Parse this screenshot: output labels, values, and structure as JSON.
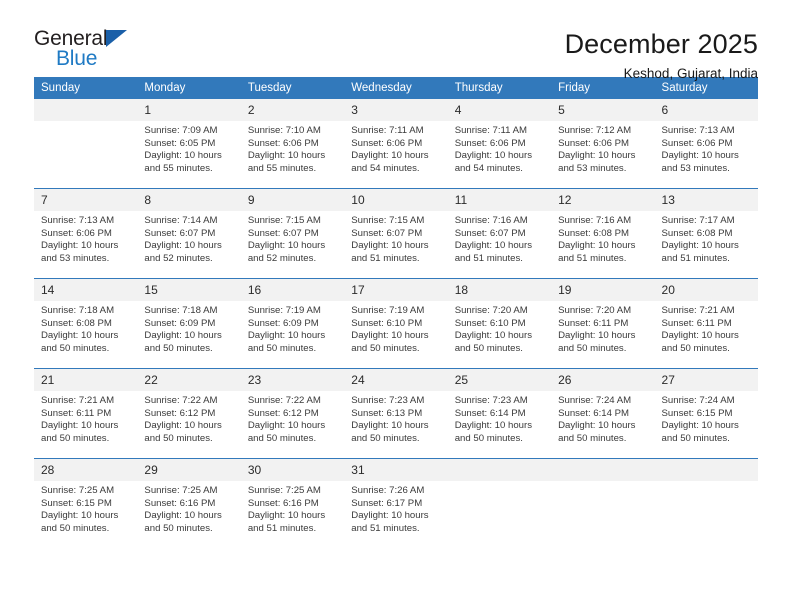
{
  "brand": {
    "name_part1": "General",
    "name_part2": "Blue",
    "accent_color": "#1f7ac4",
    "triangle_color": "#1a5fa8"
  },
  "header": {
    "title": "December 2025",
    "subtitle": "Keshod, Gujarat, India"
  },
  "calendar": {
    "header_bg": "#3279bb",
    "daynum_bg": "#f2f2f2",
    "weekday_headers": [
      "Sunday",
      "Monday",
      "Tuesday",
      "Wednesday",
      "Thursday",
      "Friday",
      "Saturday"
    ],
    "weeks": [
      [
        {
          "day": "",
          "sunrise": "",
          "sunset": "",
          "daylight_line1": "",
          "daylight_line2": "",
          "blank": true
        },
        {
          "day": "1",
          "sunrise": "Sunrise: 7:09 AM",
          "sunset": "Sunset: 6:05 PM",
          "daylight_line1": "Daylight: 10 hours",
          "daylight_line2": "and 55 minutes."
        },
        {
          "day": "2",
          "sunrise": "Sunrise: 7:10 AM",
          "sunset": "Sunset: 6:06 PM",
          "daylight_line1": "Daylight: 10 hours",
          "daylight_line2": "and 55 minutes."
        },
        {
          "day": "3",
          "sunrise": "Sunrise: 7:11 AM",
          "sunset": "Sunset: 6:06 PM",
          "daylight_line1": "Daylight: 10 hours",
          "daylight_line2": "and 54 minutes."
        },
        {
          "day": "4",
          "sunrise": "Sunrise: 7:11 AM",
          "sunset": "Sunset: 6:06 PM",
          "daylight_line1": "Daylight: 10 hours",
          "daylight_line2": "and 54 minutes."
        },
        {
          "day": "5",
          "sunrise": "Sunrise: 7:12 AM",
          "sunset": "Sunset: 6:06 PM",
          "daylight_line1": "Daylight: 10 hours",
          "daylight_line2": "and 53 minutes."
        },
        {
          "day": "6",
          "sunrise": "Sunrise: 7:13 AM",
          "sunset": "Sunset: 6:06 PM",
          "daylight_line1": "Daylight: 10 hours",
          "daylight_line2": "and 53 minutes."
        }
      ],
      [
        {
          "day": "7",
          "sunrise": "Sunrise: 7:13 AM",
          "sunset": "Sunset: 6:06 PM",
          "daylight_line1": "Daylight: 10 hours",
          "daylight_line2": "and 53 minutes."
        },
        {
          "day": "8",
          "sunrise": "Sunrise: 7:14 AM",
          "sunset": "Sunset: 6:07 PM",
          "daylight_line1": "Daylight: 10 hours",
          "daylight_line2": "and 52 minutes."
        },
        {
          "day": "9",
          "sunrise": "Sunrise: 7:15 AM",
          "sunset": "Sunset: 6:07 PM",
          "daylight_line1": "Daylight: 10 hours",
          "daylight_line2": "and 52 minutes."
        },
        {
          "day": "10",
          "sunrise": "Sunrise: 7:15 AM",
          "sunset": "Sunset: 6:07 PM",
          "daylight_line1": "Daylight: 10 hours",
          "daylight_line2": "and 51 minutes."
        },
        {
          "day": "11",
          "sunrise": "Sunrise: 7:16 AM",
          "sunset": "Sunset: 6:07 PM",
          "daylight_line1": "Daylight: 10 hours",
          "daylight_line2": "and 51 minutes."
        },
        {
          "day": "12",
          "sunrise": "Sunrise: 7:16 AM",
          "sunset": "Sunset: 6:08 PM",
          "daylight_line1": "Daylight: 10 hours",
          "daylight_line2": "and 51 minutes."
        },
        {
          "day": "13",
          "sunrise": "Sunrise: 7:17 AM",
          "sunset": "Sunset: 6:08 PM",
          "daylight_line1": "Daylight: 10 hours",
          "daylight_line2": "and 51 minutes."
        }
      ],
      [
        {
          "day": "14",
          "sunrise": "Sunrise: 7:18 AM",
          "sunset": "Sunset: 6:08 PM",
          "daylight_line1": "Daylight: 10 hours",
          "daylight_line2": "and 50 minutes."
        },
        {
          "day": "15",
          "sunrise": "Sunrise: 7:18 AM",
          "sunset": "Sunset: 6:09 PM",
          "daylight_line1": "Daylight: 10 hours",
          "daylight_line2": "and 50 minutes."
        },
        {
          "day": "16",
          "sunrise": "Sunrise: 7:19 AM",
          "sunset": "Sunset: 6:09 PM",
          "daylight_line1": "Daylight: 10 hours",
          "daylight_line2": "and 50 minutes."
        },
        {
          "day": "17",
          "sunrise": "Sunrise: 7:19 AM",
          "sunset": "Sunset: 6:10 PM",
          "daylight_line1": "Daylight: 10 hours",
          "daylight_line2": "and 50 minutes."
        },
        {
          "day": "18",
          "sunrise": "Sunrise: 7:20 AM",
          "sunset": "Sunset: 6:10 PM",
          "daylight_line1": "Daylight: 10 hours",
          "daylight_line2": "and 50 minutes."
        },
        {
          "day": "19",
          "sunrise": "Sunrise: 7:20 AM",
          "sunset": "Sunset: 6:11 PM",
          "daylight_line1": "Daylight: 10 hours",
          "daylight_line2": "and 50 minutes."
        },
        {
          "day": "20",
          "sunrise": "Sunrise: 7:21 AM",
          "sunset": "Sunset: 6:11 PM",
          "daylight_line1": "Daylight: 10 hours",
          "daylight_line2": "and 50 minutes."
        }
      ],
      [
        {
          "day": "21",
          "sunrise": "Sunrise: 7:21 AM",
          "sunset": "Sunset: 6:11 PM",
          "daylight_line1": "Daylight: 10 hours",
          "daylight_line2": "and 50 minutes."
        },
        {
          "day": "22",
          "sunrise": "Sunrise: 7:22 AM",
          "sunset": "Sunset: 6:12 PM",
          "daylight_line1": "Daylight: 10 hours",
          "daylight_line2": "and 50 minutes."
        },
        {
          "day": "23",
          "sunrise": "Sunrise: 7:22 AM",
          "sunset": "Sunset: 6:12 PM",
          "daylight_line1": "Daylight: 10 hours",
          "daylight_line2": "and 50 minutes."
        },
        {
          "day": "24",
          "sunrise": "Sunrise: 7:23 AM",
          "sunset": "Sunset: 6:13 PM",
          "daylight_line1": "Daylight: 10 hours",
          "daylight_line2": "and 50 minutes."
        },
        {
          "day": "25",
          "sunrise": "Sunrise: 7:23 AM",
          "sunset": "Sunset: 6:14 PM",
          "daylight_line1": "Daylight: 10 hours",
          "daylight_line2": "and 50 minutes."
        },
        {
          "day": "26",
          "sunrise": "Sunrise: 7:24 AM",
          "sunset": "Sunset: 6:14 PM",
          "daylight_line1": "Daylight: 10 hours",
          "daylight_line2": "and 50 minutes."
        },
        {
          "day": "27",
          "sunrise": "Sunrise: 7:24 AM",
          "sunset": "Sunset: 6:15 PM",
          "daylight_line1": "Daylight: 10 hours",
          "daylight_line2": "and 50 minutes."
        }
      ],
      [
        {
          "day": "28",
          "sunrise": "Sunrise: 7:25 AM",
          "sunset": "Sunset: 6:15 PM",
          "daylight_line1": "Daylight: 10 hours",
          "daylight_line2": "and 50 minutes."
        },
        {
          "day": "29",
          "sunrise": "Sunrise: 7:25 AM",
          "sunset": "Sunset: 6:16 PM",
          "daylight_line1": "Daylight: 10 hours",
          "daylight_line2": "and 50 minutes."
        },
        {
          "day": "30",
          "sunrise": "Sunrise: 7:25 AM",
          "sunset": "Sunset: 6:16 PM",
          "daylight_line1": "Daylight: 10 hours",
          "daylight_line2": "and 51 minutes."
        },
        {
          "day": "31",
          "sunrise": "Sunrise: 7:26 AM",
          "sunset": "Sunset: 6:17 PM",
          "daylight_line1": "Daylight: 10 hours",
          "daylight_line2": "and 51 minutes."
        },
        {
          "day": "",
          "sunrise": "",
          "sunset": "",
          "daylight_line1": "",
          "daylight_line2": "",
          "blank": true
        },
        {
          "day": "",
          "sunrise": "",
          "sunset": "",
          "daylight_line1": "",
          "daylight_line2": "",
          "blank": true
        },
        {
          "day": "",
          "sunrise": "",
          "sunset": "",
          "daylight_line1": "",
          "daylight_line2": "",
          "blank": true
        }
      ]
    ]
  }
}
